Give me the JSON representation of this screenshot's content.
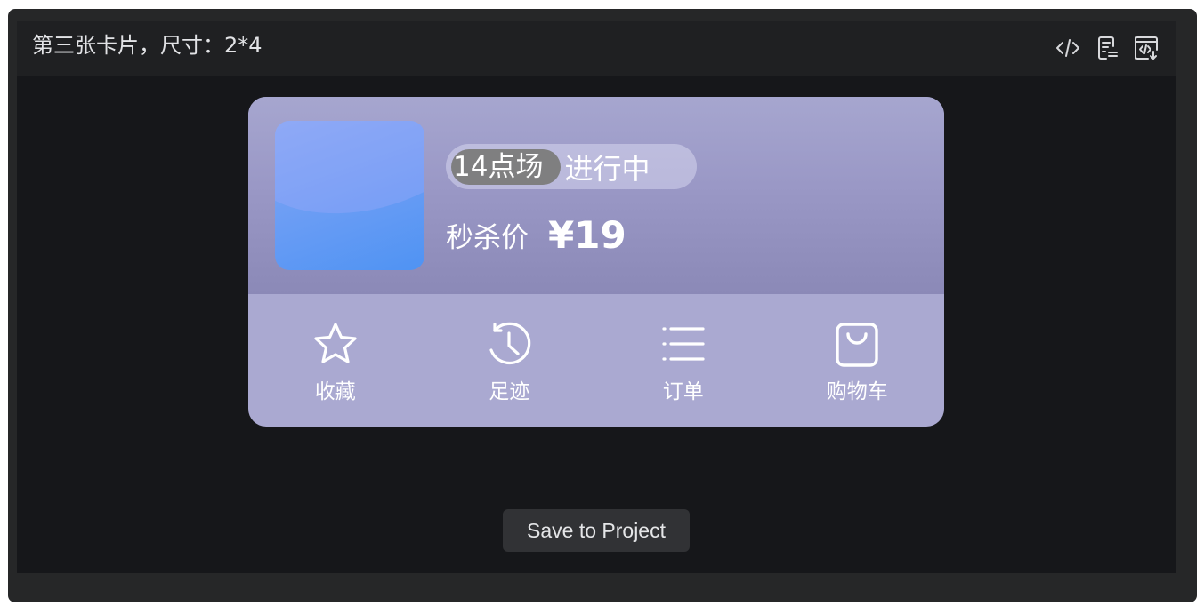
{
  "header": {
    "title": "第三张卡片，尺寸：2*4",
    "tools": [
      {
        "name": "code-icon"
      },
      {
        "name": "file-icon"
      },
      {
        "name": "export-code-icon"
      }
    ]
  },
  "card": {
    "background_color": "#aaa9d1",
    "session_time": "14点场",
    "session_status": "进行中",
    "price_label": "秒杀价",
    "price_value": "¥19",
    "actions": [
      {
        "icon": "star-icon",
        "label": "收藏"
      },
      {
        "icon": "history-clock-icon",
        "label": "足迹"
      },
      {
        "icon": "list-icon",
        "label": "订单"
      },
      {
        "icon": "shopping-bag-icon",
        "label": "购物车"
      }
    ]
  },
  "footer": {
    "save_label": "Save to Project"
  }
}
